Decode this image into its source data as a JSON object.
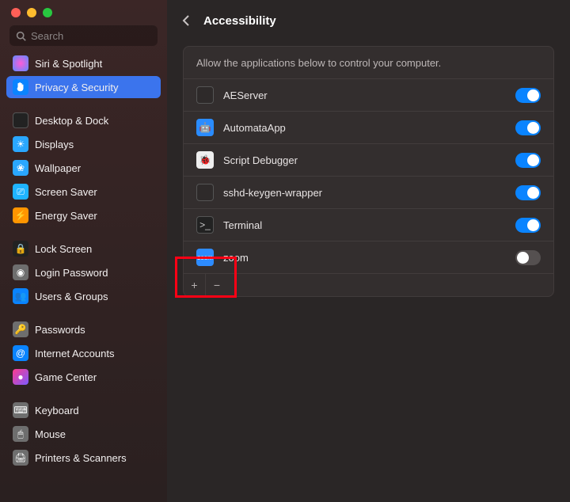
{
  "window": {
    "search_placeholder": "Search"
  },
  "sidebar": {
    "items": [
      {
        "label": "Siri & Spotlight"
      },
      {
        "label": "Privacy & Security"
      },
      {
        "label": "Desktop & Dock"
      },
      {
        "label": "Displays"
      },
      {
        "label": "Wallpaper"
      },
      {
        "label": "Screen Saver"
      },
      {
        "label": "Energy Saver"
      },
      {
        "label": "Lock Screen"
      },
      {
        "label": "Login Password"
      },
      {
        "label": "Users & Groups"
      },
      {
        "label": "Passwords"
      },
      {
        "label": "Internet Accounts"
      },
      {
        "label": "Game Center"
      },
      {
        "label": "Keyboard"
      },
      {
        "label": "Mouse"
      },
      {
        "label": "Printers & Scanners"
      }
    ]
  },
  "main": {
    "title": "Accessibility",
    "description": "Allow the applications below to control your computer.",
    "apps": [
      {
        "name": "AEServer",
        "enabled": true
      },
      {
        "name": "AutomataApp",
        "enabled": true
      },
      {
        "name": "Script Debugger",
        "enabled": true
      },
      {
        "name": "sshd-keygen-wrapper",
        "enabled": true
      },
      {
        "name": "Terminal",
        "enabled": true
      },
      {
        "name": "zoom",
        "enabled": false
      }
    ],
    "add_label": "+",
    "remove_label": "−"
  },
  "colors": {
    "accent": "#0a84ff",
    "highlight": "#ff0015"
  }
}
